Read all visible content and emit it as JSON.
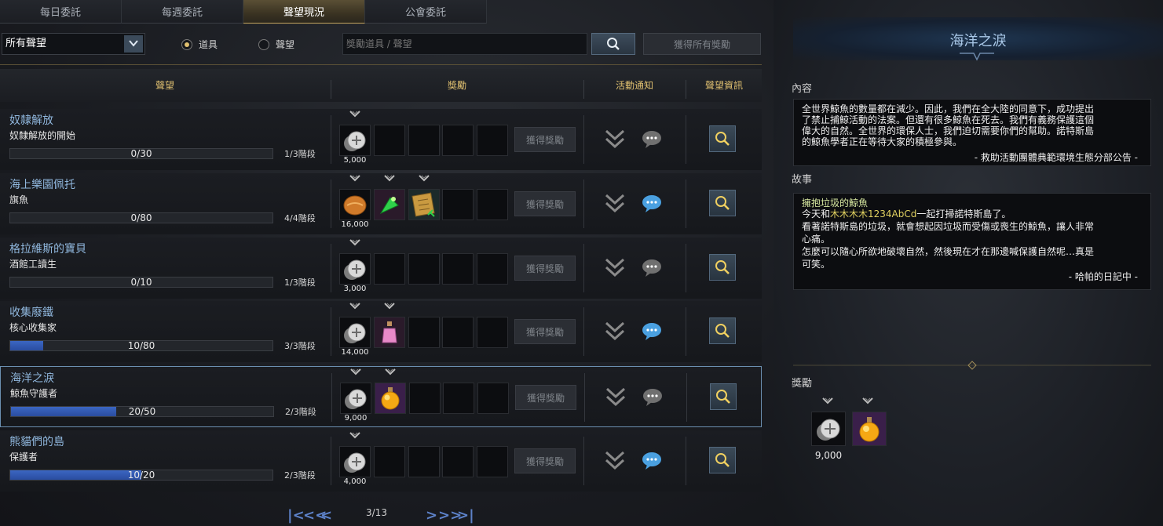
{
  "tabs": [
    "每日委託",
    "每週委託",
    "聲望現況",
    "公會委託"
  ],
  "filter": {
    "select_value": "所有聲望",
    "radio_items": "道具",
    "radio_reputation": "聲望",
    "search_placeholder": "獎勵道具 / 聲望",
    "claim_all": "獲得所有獎勵"
  },
  "header": {
    "reputation": "聲望",
    "reward": "獎勵",
    "activity_notice": "活動通知",
    "reputation_info": "聲望資訊"
  },
  "rows": [
    {
      "title": "奴隸解放",
      "subtitle": "奴隸解放的開始",
      "progress_text": "0/30",
      "progress": 0.0,
      "stage": "1/3階段",
      "qty": "5,000",
      "claim": "獲得獎勵"
    },
    {
      "title": "海上樂園佩托",
      "subtitle": "旗魚",
      "progress_text": "0/80",
      "progress": 0.0,
      "stage": "4/4階段",
      "qty": "16,000",
      "claim": "獲得獎勵"
    },
    {
      "title": "格拉維斯的寶貝",
      "subtitle": "酒館工讀生",
      "progress_text": "0/10",
      "progress": 0.0,
      "stage": "1/3階段",
      "qty": "3,000",
      "claim": "獲得獎勵"
    },
    {
      "title": "收集廢鐵",
      "subtitle": "核心收集家",
      "progress_text": "10/80",
      "progress": 0.125,
      "stage": "3/3階段",
      "qty": "14,000",
      "claim": "獲得獎勵"
    },
    {
      "title": "海洋之淚",
      "subtitle": "鯨魚守護者",
      "progress_text": "20/50",
      "progress": 0.4,
      "stage": "2/3階段",
      "qty": "9,000",
      "claim": "獲得獎勵"
    },
    {
      "title": "熊貓們的島",
      "subtitle": "保護者",
      "progress_text": "10/20",
      "progress": 0.5,
      "stage": "2/3階段",
      "qty": "4,000",
      "claim": "獲得獎勵"
    }
  ],
  "pager": {
    "text": "3/13"
  },
  "panel": {
    "title": "海洋之淚",
    "content_label": "內容",
    "content_lines": [
      "全世界鯨魚的數量都在減少。因此，我們在全大陸的同意下，成功提出",
      "了禁止捕鯨活動的法案。但還有很多鯨魚在死去。我們有義務保護這個",
      "偉大的自然。全世界的環保人士，我們迫切需要你們的幫助。諾特斯島",
      "的鯨魚學者正在等待大家的積極參與。"
    ],
    "content_sign": "- 救助活動團體典範環境生態分部公告 -",
    "story_label": "故事",
    "story_title": "擁抱垃圾的鯨魚",
    "story_line1_pre": "今天和",
    "story_line1_name": "木木木木1234AbCd",
    "story_line1_post": "一起打掃諾特斯島了。",
    "story_lines": [
      "看著諾特斯島的垃圾，就會想起因垃圾而受傷或喪生的鯨魚，讓人非常",
      "心痛。",
      "怎麼可以隨心所欲地破壞自然，然後現在才在那邊喊保護自然呢…真是",
      "可笑。"
    ],
    "story_sign": "- 哈帕的日記中 -",
    "reward_label": "獎勵",
    "reward_qty": "9,000"
  }
}
